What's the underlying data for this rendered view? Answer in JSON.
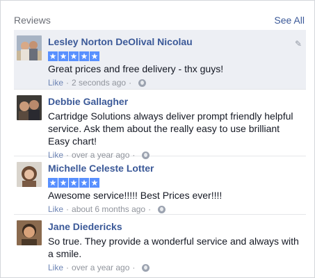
{
  "header": {
    "title": "Reviews",
    "see_all": "See All"
  },
  "reviews": [
    {
      "name": "Lesley Norton DeOlival Nicolau",
      "stars": 5,
      "text": "Great prices and free delivery - thx guys!",
      "like": "Like",
      "time": "2 seconds ago"
    },
    {
      "name": "Debbie Gallagher",
      "stars": 0,
      "text": "Cartridge Solutions always deliver prompt friendly helpful service. Ask them about the really easy to use brilliant Easy chart!",
      "like": "Like",
      "time": "over a year ago"
    },
    {
      "name": "Michelle Celeste Lotter",
      "stars": 5,
      "text": "Awesome service!!!!! Best Prices ever!!!!",
      "like": "Like",
      "time": "about 6 months ago"
    },
    {
      "name": "Jane Diedericks",
      "stars": 0,
      "text": "So true. They provide a wonderful service and always with a smile.",
      "like": "Like",
      "time": "over a year ago"
    }
  ],
  "colors": {
    "link": "#3b5998",
    "star": "#5890ff",
    "highlight": "#edeff4"
  }
}
